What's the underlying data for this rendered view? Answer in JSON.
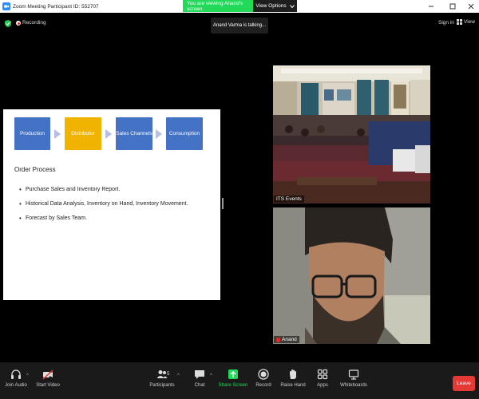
{
  "window": {
    "title": "Zoom Meeting Participant ID: 552707",
    "controls": [
      "minimize",
      "maximize",
      "close"
    ]
  },
  "banner": {
    "viewing_text": "You are viewing Anand's screen",
    "options_label": "View Options"
  },
  "status": {
    "recording_label": "Recording",
    "talking_text": "Anand Varma is talking...",
    "sign_in_label": "Sign in",
    "view_label": "View"
  },
  "slide": {
    "flow": [
      {
        "label": "Production",
        "color": "#4472c4"
      },
      {
        "label": "Distributor",
        "color": "#f0b400"
      },
      {
        "label": "Sales Channels",
        "color": "#4472c4"
      },
      {
        "label": "Consumption",
        "color": "#4472c4"
      }
    ],
    "heading": "Order Process",
    "bullets": [
      "Purchase Sales and Inventory Report.",
      "Historical Data Analysis, Inventory on Hand, Inventory Movement.",
      "Forecast by Sales Team."
    ]
  },
  "videos": [
    {
      "name": "ITS Events",
      "muted": false
    },
    {
      "name": "Anand",
      "muted": true
    }
  ],
  "toolbar": {
    "join_audio": "Join Audio",
    "start_video": "Start Video",
    "participants": "Participants",
    "participants_count": "5",
    "chat": "Chat",
    "share_screen": "Share Screen",
    "record": "Record",
    "raise_hand": "Raise Hand",
    "apps": "Apps",
    "whiteboards": "Whiteboards",
    "leave": "Leave"
  },
  "colors": {
    "banner_green": "#23d959",
    "share_green": "#23d959",
    "leave_red": "#e53935",
    "zoom_blue": "#2d8cff"
  }
}
